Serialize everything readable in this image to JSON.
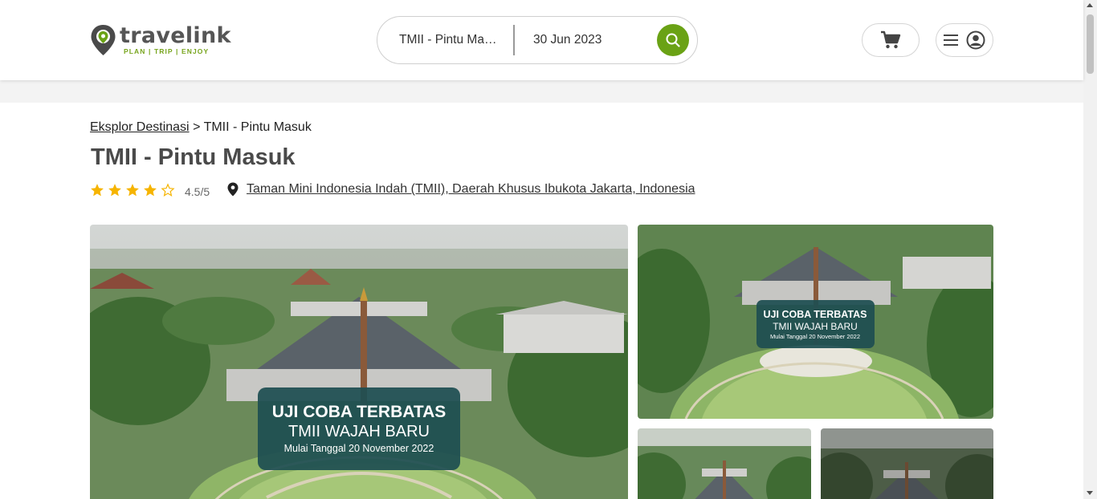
{
  "brand": {
    "name": "travelink",
    "tagline": "PLAN | TRIP | ENJOY",
    "accent_color": "#6aa215"
  },
  "search": {
    "destination": "TMII - Pintu Masuk",
    "date": "30 Jun 2023",
    "button_icon": "search-icon"
  },
  "header_actions": {
    "cart_icon": "cart-icon",
    "menu_icon": "hamburger-icon",
    "account_icon": "user-circle-icon"
  },
  "breadcrumb": {
    "parent": "Eksplor Destinasi",
    "separator": ">",
    "current": "TMII - Pintu Masuk"
  },
  "page": {
    "title": "TMII - Pintu Masuk",
    "rating_value": "4.5/5",
    "stars_filled": 4,
    "stars_total": 5,
    "location": "Taman Mini Indonesia Indah (TMII), Daerah Khusus Ibukota Jakarta, Indonesia"
  },
  "gallery": {
    "banner_line1": "UJI COBA TERBATAS",
    "banner_line2": "TMII WAJAH BARU",
    "banner_line3": "Mulai Tanggal 20 November 2022",
    "banner_color": "#1e4f52"
  }
}
